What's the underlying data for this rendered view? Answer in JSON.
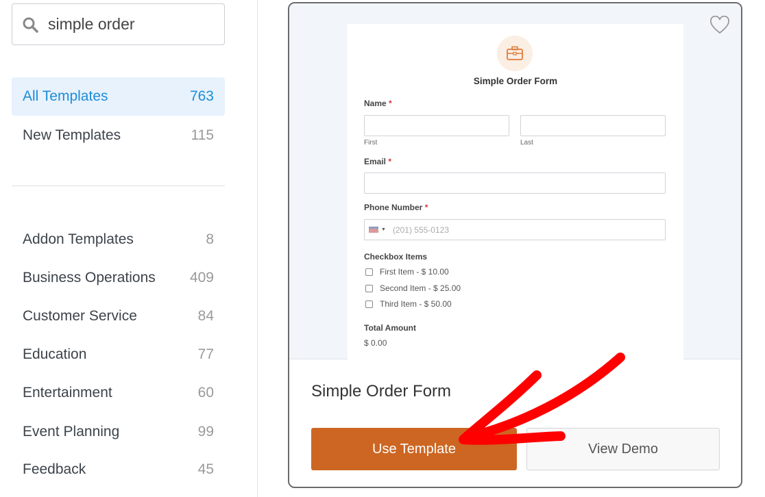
{
  "search": {
    "value": "simple order",
    "icon": "search-icon"
  },
  "categories_top": [
    {
      "label": "All Templates",
      "count": "763",
      "active": true
    },
    {
      "label": "New Templates",
      "count": "115"
    }
  ],
  "categories": [
    {
      "label": "Addon Templates",
      "count": "8"
    },
    {
      "label": "Business Operations",
      "count": "409"
    },
    {
      "label": "Customer Service",
      "count": "84"
    },
    {
      "label": "Education",
      "count": "77"
    },
    {
      "label": "Entertainment",
      "count": "60"
    },
    {
      "label": "Event Planning",
      "count": "99"
    },
    {
      "label": "Feedback",
      "count": "45"
    }
  ],
  "card": {
    "title": "Simple Order Form",
    "use_label": "Use Template",
    "demo_label": "View Demo",
    "accent": "#cd6622",
    "preview": {
      "title": "Simple Order Form",
      "name_label": "Name",
      "first": "First",
      "last": "Last",
      "email_label": "Email",
      "phone_label": "Phone Number",
      "phone_placeholder": "(201) 555-0123",
      "checkbox_label": "Checkbox Items",
      "items": [
        "First Item - $ 10.00",
        "Second Item - $ 25.00",
        "Third Item - $ 50.00"
      ],
      "total_label": "Total Amount",
      "total_value": "$ 0.00",
      "required": "*"
    }
  },
  "annotation_color": "#ff0000"
}
